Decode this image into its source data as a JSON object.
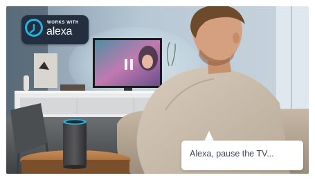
{
  "badge": {
    "top_text": "WORKS WITH",
    "main_text": "alexa",
    "icon": "alexa-logo-icon"
  },
  "speech_bubble": {
    "text": "Alexa, pause the TV..."
  },
  "tv": {
    "overlay_icon": "pause-icon"
  },
  "colors": {
    "alexa_blue": "#1fb6e6",
    "badge_bg": "#232f3e",
    "speech_text": "#3c4a5a",
    "wall": "#a8b8c6"
  }
}
